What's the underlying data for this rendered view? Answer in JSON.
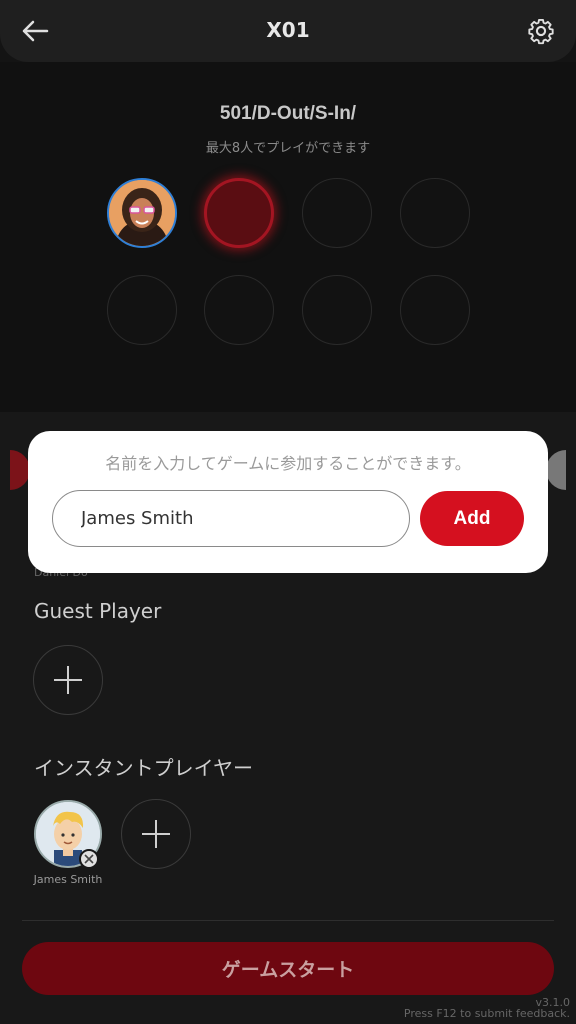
{
  "header": {
    "title": "X01",
    "back_icon": "back-arrow-icon",
    "settings_icon": "gear-icon"
  },
  "game": {
    "mode": "501/D-Out/S-In/",
    "max_players_text": "最大8人でプレイができます"
  },
  "player_slots": [
    {
      "state": "avatar"
    },
    {
      "state": "selected"
    },
    {
      "state": "empty"
    },
    {
      "state": "empty"
    },
    {
      "state": "empty"
    },
    {
      "state": "empty"
    },
    {
      "state": "empty"
    },
    {
      "state": "empty"
    }
  ],
  "modal": {
    "hint": "名前を入力してゲームに参加することができます。",
    "input_value": "James Smith",
    "add_label": "Add"
  },
  "sections": {
    "partial_text": "Daniel Do",
    "guest_label": "Guest Player",
    "instant_label": "インスタントプレイヤー"
  },
  "instant_player": {
    "name": "James Smith"
  },
  "footer": {
    "start_label": "ゲームスタート",
    "version": "v3.1.0",
    "feedback": "Press F12 to submit feedback."
  },
  "colors": {
    "accent": "#d5101f",
    "start_button": "#6e0710",
    "avatar_border": "#2f7fd6"
  }
}
